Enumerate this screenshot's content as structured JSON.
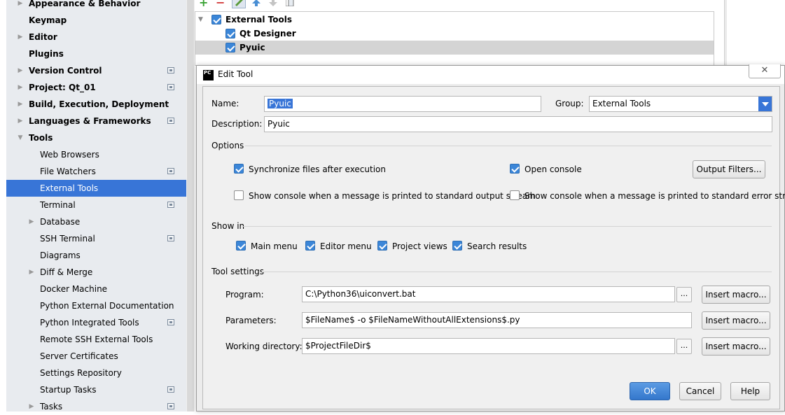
{
  "sidebar": {
    "items": [
      {
        "label": "Appearance & Behavior",
        "bold": true,
        "expander": true,
        "project_icon": false
      },
      {
        "label": "Keymap",
        "bold": true,
        "expander": false,
        "project_icon": false
      },
      {
        "label": "Editor",
        "bold": true,
        "expander": true,
        "project_icon": false
      },
      {
        "label": "Plugins",
        "bold": true,
        "expander": false,
        "project_icon": false
      },
      {
        "label": "Version Control",
        "bold": true,
        "expander": true,
        "project_icon": true
      },
      {
        "label": "Project: Qt_01",
        "bold": true,
        "expander": true,
        "project_icon": true
      },
      {
        "label": "Build, Execution, Deployment",
        "bold": true,
        "expander": true,
        "project_icon": false
      },
      {
        "label": "Languages & Frameworks",
        "bold": true,
        "expander": true,
        "project_icon": true
      },
      {
        "label": "Tools",
        "bold": true,
        "expander": true,
        "expanded": true,
        "project_icon": false
      },
      {
        "label": "Web Browsers",
        "bold": false,
        "expander": false,
        "project_icon": false
      },
      {
        "label": "File Watchers",
        "bold": false,
        "expander": false,
        "project_icon": true
      },
      {
        "label": "External Tools",
        "bold": false,
        "expander": false,
        "project_icon": false,
        "selected": true
      },
      {
        "label": "Terminal",
        "bold": false,
        "expander": false,
        "project_icon": true
      },
      {
        "label": "Database",
        "bold": false,
        "expander": true,
        "project_icon": false
      },
      {
        "label": "SSH Terminal",
        "bold": false,
        "expander": false,
        "project_icon": true
      },
      {
        "label": "Diagrams",
        "bold": false,
        "expander": false,
        "project_icon": false
      },
      {
        "label": "Diff & Merge",
        "bold": false,
        "expander": true,
        "project_icon": false
      },
      {
        "label": "Docker Machine",
        "bold": false,
        "expander": false,
        "project_icon": false
      },
      {
        "label": "Python External Documentation",
        "bold": false,
        "expander": false,
        "project_icon": false
      },
      {
        "label": "Python Integrated Tools",
        "bold": false,
        "expander": false,
        "project_icon": true
      },
      {
        "label": "Remote SSH External Tools",
        "bold": false,
        "expander": false,
        "project_icon": false
      },
      {
        "label": "Server Certificates",
        "bold": false,
        "expander": false,
        "project_icon": false
      },
      {
        "label": "Settings Repository",
        "bold": false,
        "expander": false,
        "project_icon": false
      },
      {
        "label": "Startup Tasks",
        "bold": false,
        "expander": false,
        "project_icon": true
      },
      {
        "label": "Tasks",
        "bold": false,
        "expander": true,
        "project_icon": true
      }
    ]
  },
  "toolbar": {
    "add_icon": "plus-icon",
    "remove_icon": "minus-icon",
    "edit_icon": "pencil-icon",
    "move_up_icon": "arrow-up-icon",
    "move_down_icon": "arrow-down-icon",
    "copy_icon": "copy-icon"
  },
  "tools_tree": {
    "group": {
      "label": "External Tools",
      "checked": true
    },
    "items": [
      {
        "label": "Qt Designer",
        "checked": true,
        "selected": false
      },
      {
        "label": "Pyuic",
        "checked": true,
        "selected": true
      }
    ]
  },
  "dialog": {
    "title": "Edit Tool",
    "logo_text": "PC",
    "close_glyph": "✕",
    "name_label": "Name:",
    "name_value": "Pyuic",
    "group_label": "Group:",
    "group_value": "External Tools",
    "description_label": "Description:",
    "description_value": "Pyuic",
    "options_header": "Options",
    "options": {
      "sync_files": {
        "label": "Synchronize files after execution",
        "checked": true
      },
      "open_console": {
        "label": "Open console",
        "checked": true
      },
      "output_filters_button": "Output Filters...",
      "console_stdout": {
        "label": "Show console when a message is printed to standard output stream",
        "checked": false
      },
      "console_stderr": {
        "label": "Show console when a message is printed to standard error stream",
        "checked": false
      }
    },
    "show_in_header": "Show in",
    "show_in": {
      "main_menu": {
        "label": "Main menu",
        "checked": true
      },
      "editor_menu": {
        "label": "Editor menu",
        "checked": true
      },
      "project_views": {
        "label": "Project views",
        "checked": true
      },
      "search_results": {
        "label": "Search results",
        "checked": true
      }
    },
    "tool_settings_header": "Tool settings",
    "program_label": "Program:",
    "program_value": "C:\\Python36\\uiconvert.bat",
    "parameters_label": "Parameters:",
    "parameters_value": "$FileName$ -o $FileNameWithoutAllExtensions$.py",
    "working_dir_label": "Working directory:",
    "working_dir_value": "$ProjectFileDir$",
    "browse_label": "...",
    "insert_macro_label": "Insert macro...",
    "ok_label": "OK",
    "cancel_label": "Cancel",
    "help_label": "Help"
  },
  "colors": {
    "accent": "#3875d7",
    "sidebar_bg": "#e8ebef",
    "dialog_bg": "#f0f0f0"
  }
}
